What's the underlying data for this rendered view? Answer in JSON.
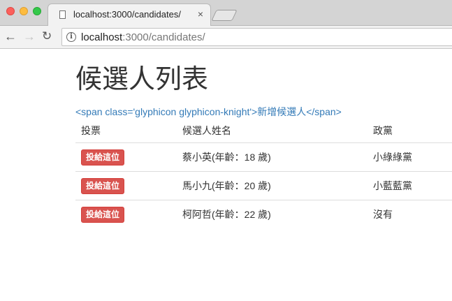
{
  "browser": {
    "tab_title": "localhost:3000/candidates/",
    "tab_close": "×",
    "url_host": "localhost",
    "url_path": ":3000/candidates/"
  },
  "page": {
    "title": "候選人列表",
    "new_link": "<span class='glyphicon glyphicon-knight'>新增候選人</span>",
    "table": {
      "headers": [
        "投票",
        "候選人姓名",
        "政黨"
      ],
      "rows": [
        {
          "vote": "投給這位",
          "name": "蔡小英(年齡：18 歲)",
          "party": "小綠綠黨"
        },
        {
          "vote": "投給這位",
          "name": "馬小九(年齡：20 歲)",
          "party": "小藍藍黨"
        },
        {
          "vote": "投給這位",
          "name": "柯阿哲(年齡：22 歲)",
          "party": "沒有"
        }
      ]
    }
  },
  "colors": {
    "danger": "#d9534f",
    "link": "#337ab7"
  }
}
